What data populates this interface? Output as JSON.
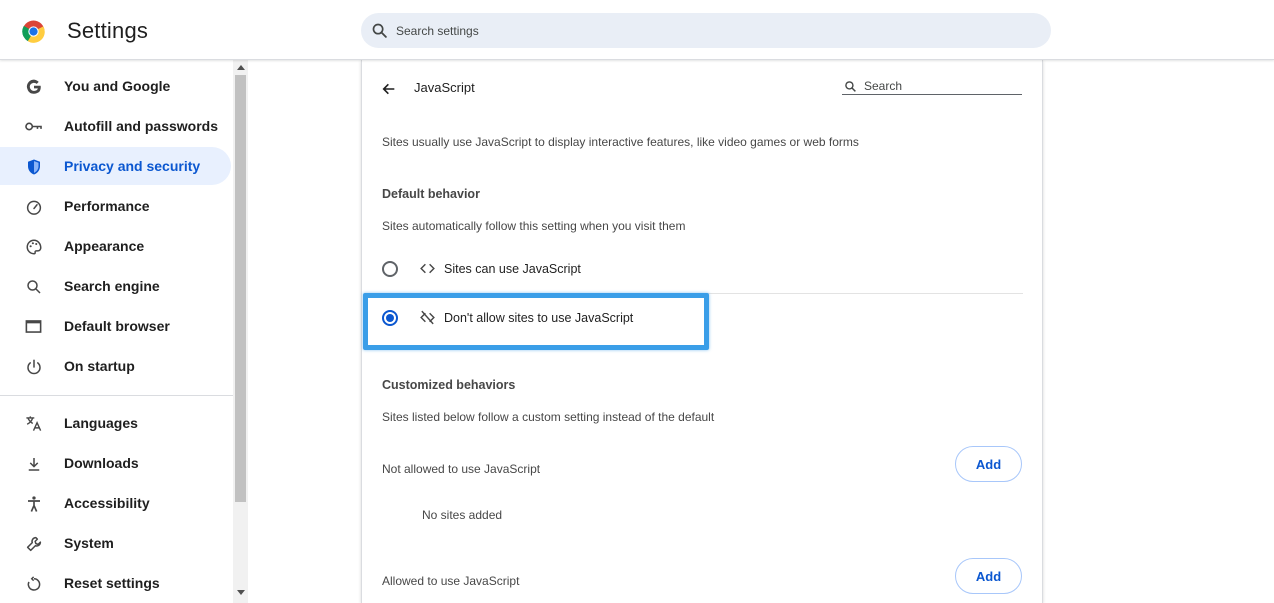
{
  "header": {
    "title": "Settings",
    "search_placeholder": "Search settings"
  },
  "sidebar": {
    "items": [
      {
        "label": "You and Google",
        "icon": "google-g-icon"
      },
      {
        "label": "Autofill and passwords",
        "icon": "key-icon"
      },
      {
        "label": "Privacy and security",
        "icon": "shield-icon",
        "active": true
      },
      {
        "label": "Performance",
        "icon": "speedometer-icon"
      },
      {
        "label": "Appearance",
        "icon": "palette-icon"
      },
      {
        "label": "Search engine",
        "icon": "search-icon"
      },
      {
        "label": "Default browser",
        "icon": "browser-window-icon"
      },
      {
        "label": "On startup",
        "icon": "power-icon"
      },
      {
        "label": "Languages",
        "icon": "translate-icon"
      },
      {
        "label": "Downloads",
        "icon": "download-icon"
      },
      {
        "label": "Accessibility",
        "icon": "accessibility-icon"
      },
      {
        "label": "System",
        "icon": "wrench-icon"
      },
      {
        "label": "Reset settings",
        "icon": "reset-icon"
      }
    ]
  },
  "page": {
    "title": "JavaScript",
    "search_placeholder": "Search",
    "description": "Sites usually use JavaScript to display interactive features, like video games or web forms",
    "default_behavior": {
      "heading": "Default behavior",
      "subtext": "Sites automatically follow this setting when you visit them",
      "options": [
        {
          "label": "Sites can use JavaScript",
          "icon": "code-brackets-icon",
          "selected": false
        },
        {
          "label": "Don't allow sites to use JavaScript",
          "icon": "code-off-icon",
          "selected": true
        }
      ]
    },
    "customized": {
      "heading": "Customized behaviors",
      "subtext": "Sites listed below follow a custom setting instead of the default",
      "not_allowed": {
        "label": "Not allowed to use JavaScript",
        "button": "Add",
        "empty": "No sites added"
      },
      "allowed": {
        "label": "Allowed to use JavaScript",
        "button": "Add"
      }
    }
  },
  "colors": {
    "accent": "#0b57d0",
    "active_bg": "#e8f0fe",
    "highlight": "#3a9ee8"
  }
}
